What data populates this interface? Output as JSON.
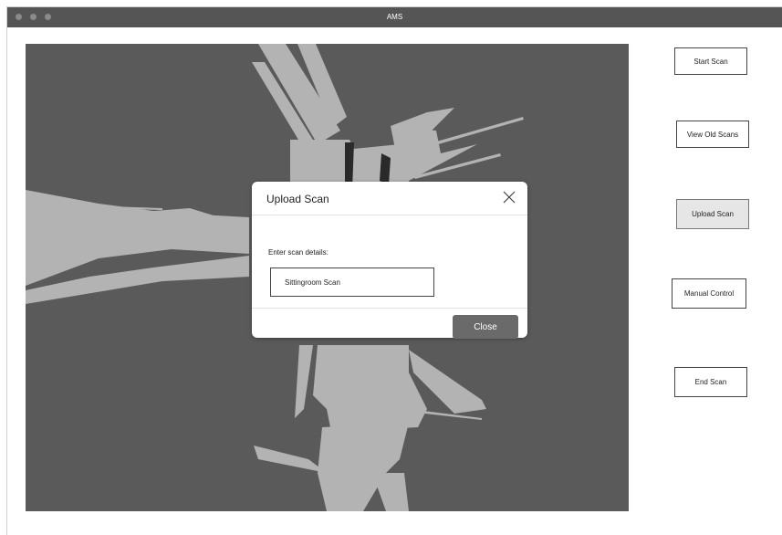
{
  "window": {
    "title": "AMS"
  },
  "map": {
    "label": "scan-map"
  },
  "sidebar": {
    "buttons": [
      {
        "label": "Start Scan"
      },
      {
        "label": "View Old Scans"
      },
      {
        "label": "Upload Scan",
        "active": true
      },
      {
        "label": "Manual Control"
      },
      {
        "label": "End Scan"
      }
    ]
  },
  "modal": {
    "title": "Upload Scan",
    "field_label": "Enter scan details:",
    "field_value": "Sittingroom Scan",
    "close_label": "Close"
  },
  "colors": {
    "titlebar": "#555555",
    "map_bg": "#5a5a5a",
    "scan_fill": "#b3b3b3",
    "close_button": "#6a6a6a"
  }
}
